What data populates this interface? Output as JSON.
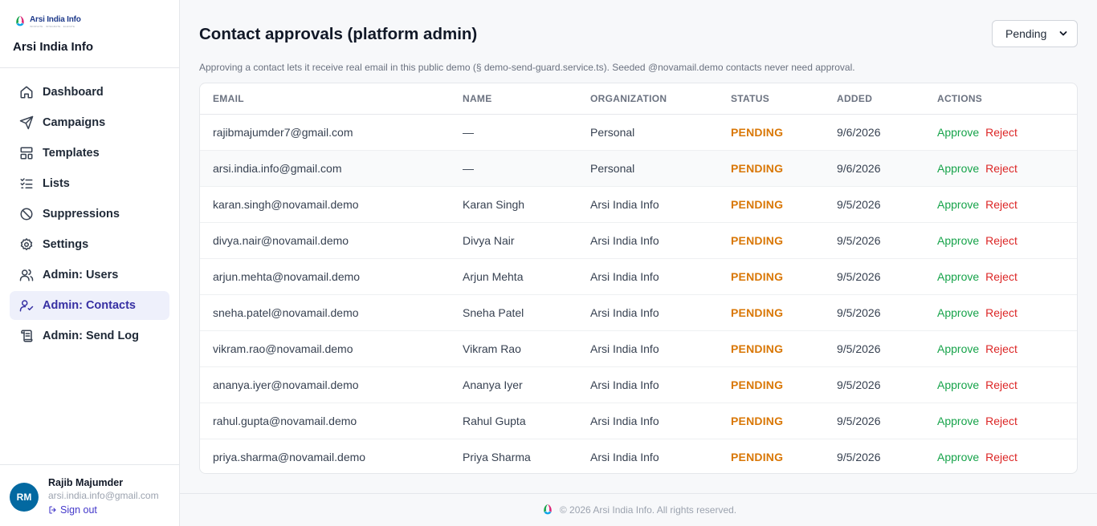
{
  "brand": {
    "logo_text": "Arsi India Info",
    "logo_tagline": "INNOVATE · INTEGRATE · ELEVATE",
    "name": "Arsi India Info"
  },
  "nav": [
    {
      "label": "Dashboard",
      "icon": "home-icon",
      "active": false
    },
    {
      "label": "Campaigns",
      "icon": "send-icon",
      "active": false
    },
    {
      "label": "Templates",
      "icon": "layout-icon",
      "active": false
    },
    {
      "label": "Lists",
      "icon": "list-check-icon",
      "active": false
    },
    {
      "label": "Suppressions",
      "icon": "ban-icon",
      "active": false
    },
    {
      "label": "Settings",
      "icon": "gear-icon",
      "active": false
    },
    {
      "label": "Admin: Users",
      "icon": "users-icon",
      "active": false
    },
    {
      "label": "Admin: Contacts",
      "icon": "user-check-icon",
      "active": true
    },
    {
      "label": "Admin: Send Log",
      "icon": "scroll-icon",
      "active": false
    }
  ],
  "user": {
    "initials": "RM",
    "name": "Rajib Majumder",
    "email": "arsi.india.info@gmail.com",
    "signout_label": "Sign out"
  },
  "page": {
    "title": "Contact approvals (platform admin)",
    "filter_value": "Pending",
    "description": "Approving a contact lets it receive real email in this public demo (§ demo-send-guard.service.ts). Seeded @novamail.demo contacts never need approval."
  },
  "table": {
    "headers": [
      "EMAIL",
      "NAME",
      "ORGANIZATION",
      "STATUS",
      "ADDED",
      "ACTIONS"
    ],
    "approve_label": "Approve",
    "reject_label": "Reject",
    "rows": [
      {
        "email": "rajibmajumder7@gmail.com",
        "name": "—",
        "organization": "Personal",
        "status": "PENDING",
        "added": "9/6/2026"
      },
      {
        "email": "arsi.india.info@gmail.com",
        "name": "—",
        "organization": "Personal",
        "status": "PENDING",
        "added": "9/6/2026"
      },
      {
        "email": "karan.singh@novamail.demo",
        "name": "Karan Singh",
        "organization": "Arsi India Info",
        "status": "PENDING",
        "added": "9/5/2026"
      },
      {
        "email": "divya.nair@novamail.demo",
        "name": "Divya Nair",
        "organization": "Arsi India Info",
        "status": "PENDING",
        "added": "9/5/2026"
      },
      {
        "email": "arjun.mehta@novamail.demo",
        "name": "Arjun Mehta",
        "organization": "Arsi India Info",
        "status": "PENDING",
        "added": "9/5/2026"
      },
      {
        "email": "sneha.patel@novamail.demo",
        "name": "Sneha Patel",
        "organization": "Arsi India Info",
        "status": "PENDING",
        "added": "9/5/2026"
      },
      {
        "email": "vikram.rao@novamail.demo",
        "name": "Vikram Rao",
        "organization": "Arsi India Info",
        "status": "PENDING",
        "added": "9/5/2026"
      },
      {
        "email": "ananya.iyer@novamail.demo",
        "name": "Ananya Iyer",
        "organization": "Arsi India Info",
        "status": "PENDING",
        "added": "9/5/2026"
      },
      {
        "email": "rahul.gupta@novamail.demo",
        "name": "Rahul Gupta",
        "organization": "Arsi India Info",
        "status": "PENDING",
        "added": "9/5/2026"
      },
      {
        "email": "priya.sharma@novamail.demo",
        "name": "Priya Sharma",
        "organization": "Arsi India Info",
        "status": "PENDING",
        "added": "9/5/2026"
      }
    ]
  },
  "footer": {
    "text": "© 2026 Arsi India Info. All rights reserved."
  },
  "colors": {
    "accent": "#3730a3",
    "active_bg": "#eef0fb",
    "pending": "#d97706",
    "approve": "#16a34a",
    "reject": "#dc2626",
    "avatar": "#0369a1"
  }
}
